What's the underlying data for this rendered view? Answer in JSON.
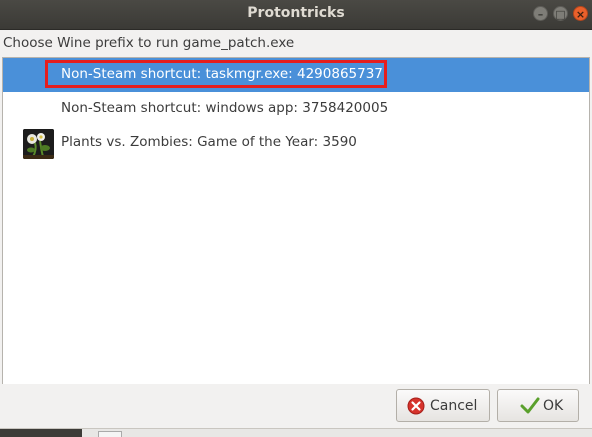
{
  "window": {
    "title": "Protontricks"
  },
  "dialog": {
    "prompt": "Choose Wine prefix to run game_patch.exe",
    "items": [
      {
        "label": "Non-Steam shortcut: taskmgr.exe: 4290865737",
        "selected": true,
        "icon": null
      },
      {
        "label": "Non-Steam shortcut: windows app: 3758420005",
        "selected": false,
        "icon": null
      },
      {
        "label": "Plants vs. Zombies: Game of the Year: 3590",
        "selected": false,
        "icon": "game-thumbnail"
      }
    ]
  },
  "buttons": {
    "cancel_label": "Cancel",
    "ok_label": "OK"
  },
  "colors": {
    "selection": "#4a90d9",
    "highlight_box": "#e51e1e",
    "titlebar": "#3b3a36"
  }
}
